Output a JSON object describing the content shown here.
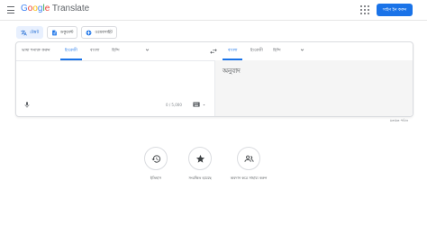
{
  "header": {
    "logo_google": "Google",
    "logo_translate": "Translate",
    "signin_label": "সাইন ইন করুন"
  },
  "modes": [
    {
      "label": "টেক্সট",
      "icon": "translate-icon",
      "active": true
    },
    {
      "label": "ডকুমেন্ট",
      "icon": "document-icon",
      "active": false
    },
    {
      "label": "ওয়েবসাইট",
      "icon": "globe-icon",
      "active": false
    }
  ],
  "source_langs": {
    "detect": "ভাষা শনাক্ত করুন",
    "english": "ইংরেজী",
    "bengali": "বাংলা",
    "hindi": "হিন্দি"
  },
  "target_langs": {
    "bengali": "বাংলা",
    "english": "ইংরেজী",
    "hindi": "হিন্দি"
  },
  "input": {
    "char_count": "0 / 5,000"
  },
  "output": {
    "placeholder": "অনুবাদ"
  },
  "feedback_label": "মতামত পাঠান",
  "bottom_actions": {
    "history": "ইতিহাস",
    "saved": "সংরক্ষিত হয়েছে",
    "contribute": "অবদান করে সাহায্য করুন"
  },
  "colors": {
    "accent": "#1a73e8",
    "active_mode_bg": "#e8f0fe",
    "output_bg": "#f5f5f5"
  }
}
